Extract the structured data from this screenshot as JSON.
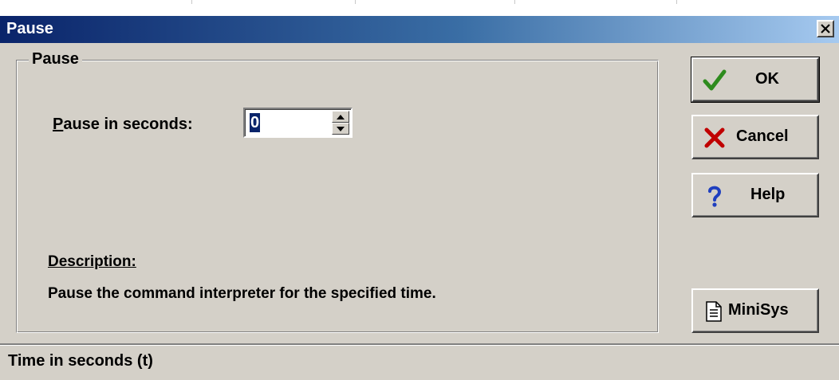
{
  "window": {
    "title": "Pause"
  },
  "group": {
    "legend": "Pause"
  },
  "field": {
    "label_accel": "P",
    "label_rest": "ause in seconds:",
    "value": "0"
  },
  "description": {
    "label": "Description:",
    "text": "Pause the command interpreter for the specified time."
  },
  "buttons": {
    "ok": "OK",
    "cancel": "Cancel",
    "help": "Help",
    "minisys": "MiniSys"
  },
  "status": {
    "text": "Time in seconds (t)"
  },
  "icons": {
    "ok": "check-icon",
    "cancel": "x-icon",
    "help": "question-icon",
    "minisys": "document-icon",
    "close": "close-icon"
  },
  "colors": {
    "title_start": "#0a246a",
    "title_end": "#a6caf0",
    "face": "#d4d0c8",
    "check": "#2e8b1e",
    "cross": "#c00000",
    "help": "#1f3fbf"
  }
}
